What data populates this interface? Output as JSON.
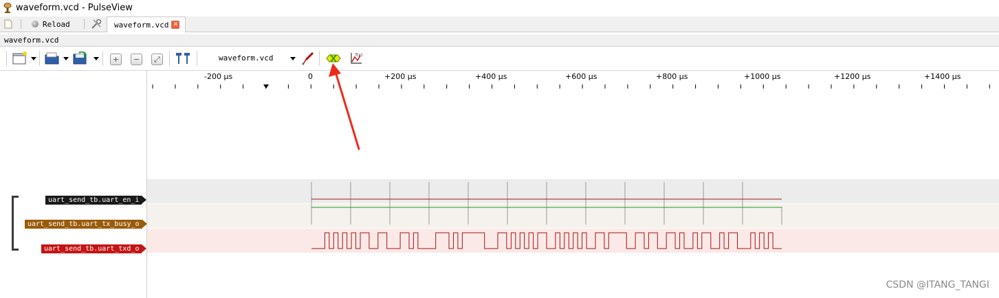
{
  "window": {
    "title": "waveform.vcd - PulseView"
  },
  "tabstrip": {
    "reload_label": "Reload",
    "session_tab_label": "waveform.vcd",
    "close_glyph": "✕"
  },
  "session": {
    "label": "waveform.vcd"
  },
  "toolbar": {
    "device_name": "waveform.vcd",
    "math_icon_label": "f(x)",
    "zoom_in_glyph": "+",
    "zoom_out_glyph": "−",
    "zoom_fit_glyph": "⤢"
  },
  "ruler": {
    "unit": "µs",
    "labels": [
      "-200 µs",
      "0",
      "+200 µs",
      "+400 µs",
      "+600 µs",
      "+800 µs",
      "+1000 µs",
      "+1200 µs",
      "+1400 µs"
    ]
  },
  "signals": [
    {
      "name": "uart_send_tb.uart_en_i",
      "color": "#1a1a1a",
      "trace_color": "#a31515",
      "row_bg": "#ececec"
    },
    {
      "name": "uart_send_tb.uart_tx_busy_o",
      "color": "#9a5b0b",
      "trace_color": "#1f9a1f",
      "row_bg": "#f5f1ec"
    },
    {
      "name": "uart_send_tb.uart_txd_o",
      "color": "#c41414",
      "trace_color": "#a31515",
      "row_bg": "#fbe9e7"
    }
  ],
  "watermark": "CSDN @ITANG_TANGI"
}
